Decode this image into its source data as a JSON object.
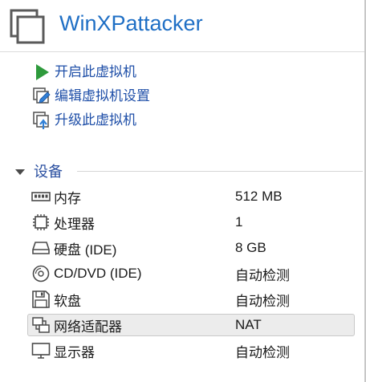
{
  "vm": {
    "title": "WinXPattacker"
  },
  "actions": [
    {
      "label": "开启此虚拟机",
      "icon": "play-icon"
    },
    {
      "label": "编辑虚拟机设置",
      "icon": "edit-settings-icon"
    },
    {
      "label": "升级此虚拟机",
      "icon": "upgrade-icon"
    }
  ],
  "devices_section": {
    "label": "设备",
    "rows": [
      {
        "name": "内存",
        "value": "512 MB",
        "icon": "memory-icon"
      },
      {
        "name": "处理器",
        "value": "1",
        "icon": "processor-icon"
      },
      {
        "name": "硬盘 (IDE)",
        "value": "8 GB",
        "icon": "hard-disk-icon"
      },
      {
        "name": "CD/DVD (IDE)",
        "value": "自动检测",
        "icon": "cd-dvd-icon"
      },
      {
        "name": "软盘",
        "value": "自动检测",
        "icon": "floppy-icon"
      },
      {
        "name": "网络适配器",
        "value": "NAT",
        "icon": "network-adapter-icon",
        "selected": true
      },
      {
        "name": "显示器",
        "value": "自动检测",
        "icon": "display-icon"
      }
    ]
  },
  "colors": {
    "title": "#1f6fc5",
    "action_text": "#1f4fa8",
    "play_green": "#2e9a3c",
    "selected_row_bg": "#ececec"
  }
}
